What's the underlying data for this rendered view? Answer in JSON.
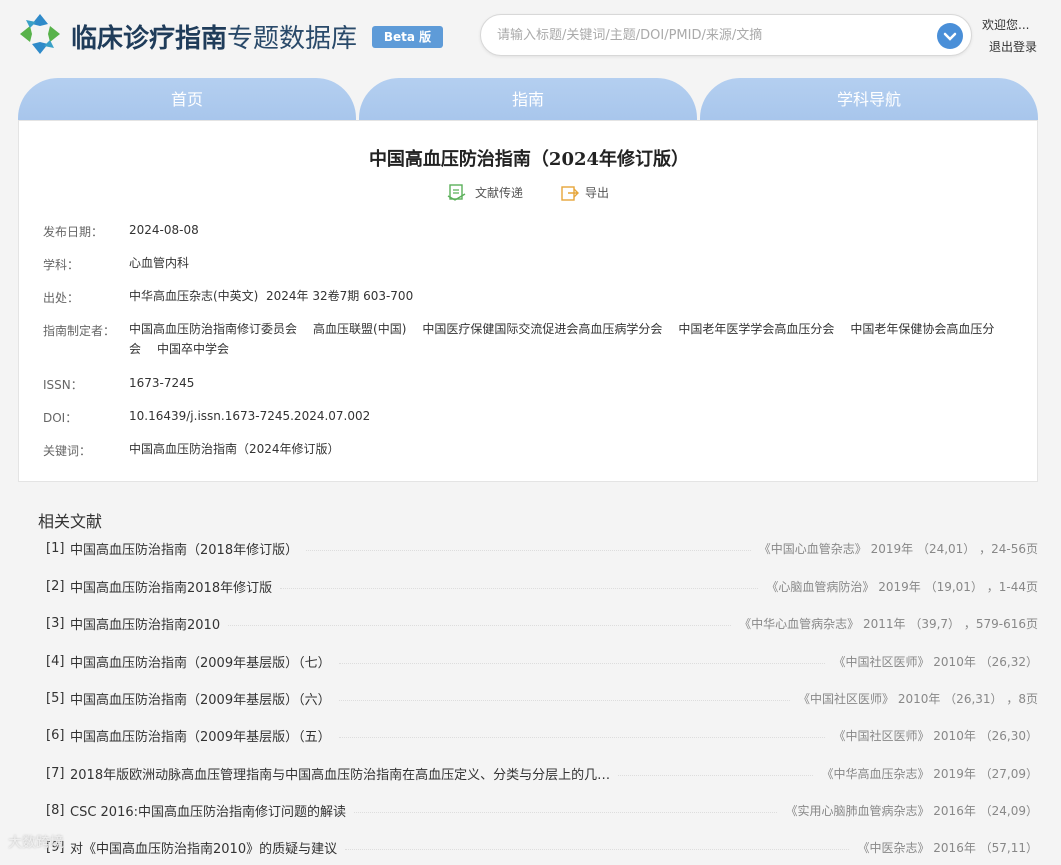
{
  "header": {
    "title_bold": "临床诊疗指南",
    "title_light": "专题数据库",
    "beta": "Beta 版",
    "search_placeholder": "请输入标题/关键词/主题/DOI/PMID/来源/文摘",
    "welcome": "欢迎您...",
    "logout": "退出登录"
  },
  "tabs": [
    "首页",
    "指南",
    "学科导航"
  ],
  "detail": {
    "title": "中国高血压防治指南（2024年修订版）",
    "action_deliver": "文献传递",
    "action_export": "导出",
    "fields": {
      "date_label": "发布日期：",
      "date": "2024-08-08",
      "subject_label": "学科：",
      "subject": "心血管内科",
      "source_label": "出处：",
      "source": "中华高血压杂志(中英文)  2024年 32卷7期 603-700",
      "makers_label": "指南制定者：",
      "makers": [
        "中国高血压防治指南修订委员会",
        "高血压联盟(中国)",
        "中国医疗保健国际交流促进会高血压病学分会",
        "中国老年医学学会高血压分会",
        "中国老年保健协会高血压分会",
        "中国卒中学会"
      ],
      "issn_label": "ISSN：",
      "issn": "1673-7245",
      "doi_label": "DOI：",
      "doi": "10.16439/j.issn.1673-7245.2024.07.002",
      "keywords_label": "关键词：",
      "keywords": "中国高血压防治指南（2024年修订版）"
    }
  },
  "related": {
    "heading": "相关文献",
    "items": [
      {
        "num": "[1]",
        "title": "中国高血压防治指南（2018年修订版）",
        "source": "《中国心血管杂志》 2019年 （24,01） ，24-56页"
      },
      {
        "num": "[2]",
        "title": "中国高血压防治指南2018年修订版",
        "source": "《心脑血管病防治》 2019年 （19,01） ，1-44页"
      },
      {
        "num": "[3]",
        "title": "中国高血压防治指南2010",
        "source": "《中华心血管病杂志》 2011年 （39,7） ，579-616页"
      },
      {
        "num": "[4]",
        "title": "中国高血压防治指南（2009年基层版）（七）",
        "source": "《中国社区医师》 2010年 （26,32）"
      },
      {
        "num": "[5]",
        "title": "中国高血压防治指南（2009年基层版）（六）",
        "source": "《中国社区医师》 2010年 （26,31） ，8页"
      },
      {
        "num": "[6]",
        "title": "中国高血压防治指南（2009年基层版）（五）",
        "source": "《中国社区医师》 2010年 （26,30）"
      },
      {
        "num": "[7]",
        "title": "2018年版欧洲动脉高血压管理指南与中国高血压防治指南在高血压定义、分类与分层上的几…",
        "source": "《中华高血压杂志》 2019年 （27,09）"
      },
      {
        "num": "[8]",
        "title": "CSC 2016:中国高血压防治指南修订问题的解读",
        "source": "《实用心脑肺血管病杂志》 2016年 （24,09）"
      },
      {
        "num": "[9]",
        "title": "对《中国高血压防治指南2010》的质疑与建议",
        "source": "《中医杂志》 2016年 （57,11）"
      }
    ]
  },
  "watermark": "大数跨境",
  "colors": {
    "tab": "#aac8ee",
    "brand": "#1f3c5a",
    "beta": "#5e9bd8",
    "search_btn": "#4a8fd8"
  }
}
